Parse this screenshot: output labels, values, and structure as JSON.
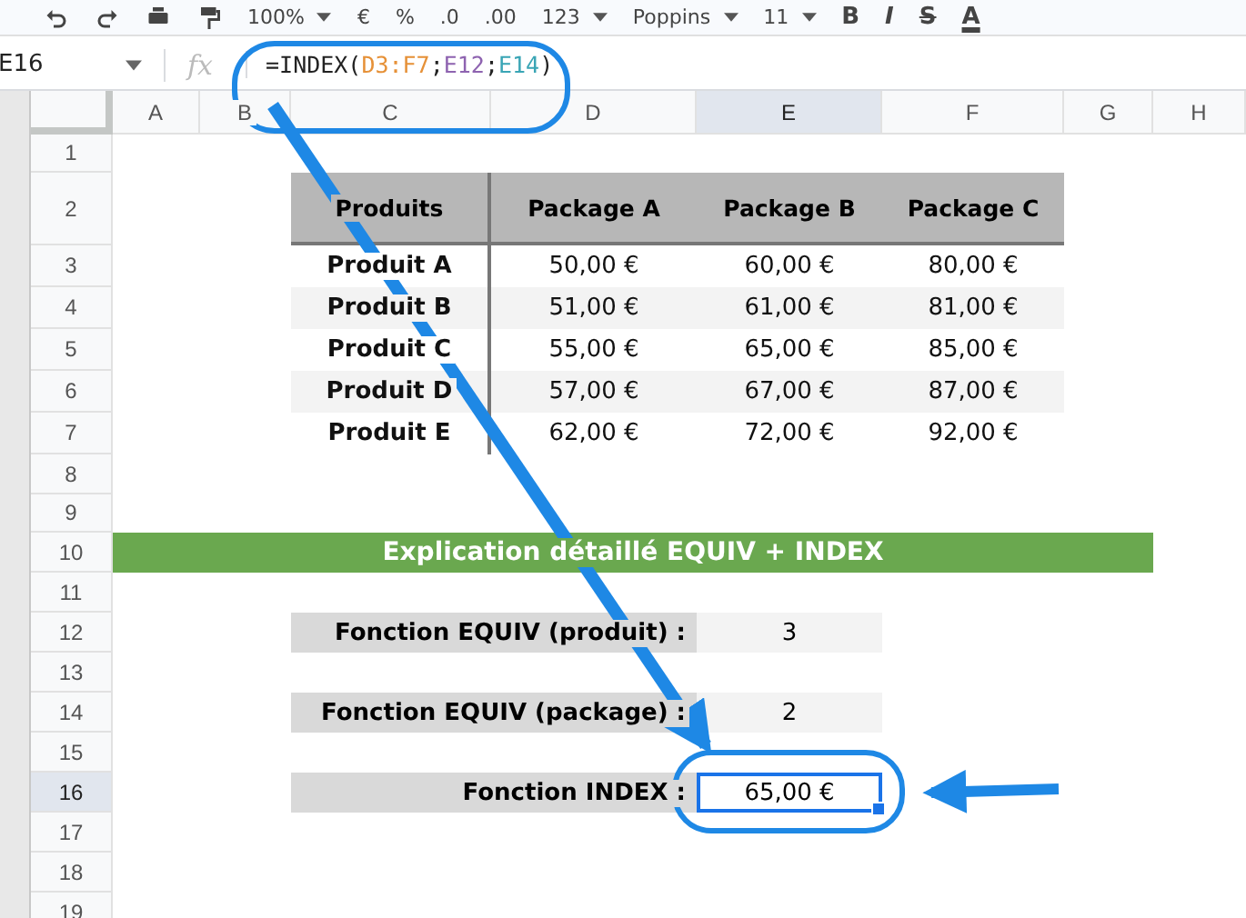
{
  "toolbar": [
    {
      "kind": "undo"
    },
    {
      "kind": "redo"
    },
    {
      "kind": "print"
    },
    {
      "kind": "paint"
    },
    {
      "kind": "text",
      "label": "100%",
      "dropdown": true
    },
    {
      "kind": "text",
      "label": "€",
      "dropdown": false
    },
    {
      "kind": "text",
      "label": "%",
      "dropdown": false
    },
    {
      "kind": "text",
      "label": ".0",
      "dropdown": false
    },
    {
      "kind": "text",
      "label": ".00",
      "dropdown": false
    },
    {
      "kind": "text",
      "label": "123",
      "dropdown": true
    },
    {
      "kind": "text",
      "label": "Poppins",
      "dropdown": true
    },
    {
      "kind": "text",
      "label": "11",
      "dropdown": true
    },
    {
      "kind": "glyph",
      "label": "B"
    },
    {
      "kind": "glyph",
      "label": "I"
    },
    {
      "kind": "glyph",
      "label": "S"
    },
    {
      "kind": "glyph",
      "label": "A"
    }
  ],
  "formula_bar": {
    "cell_ref": "E16",
    "fx": "fx",
    "parts": [
      {
        "text": "=INDEX("
      },
      {
        "text": "D3:F7",
        "color": "#e69138"
      },
      {
        "text": ";"
      },
      {
        "text": "E12",
        "color": "#8e63b0"
      },
      {
        "text": ";"
      },
      {
        "text": "E14",
        "color": "#3aa5b5"
      },
      {
        "text": ")"
      }
    ]
  },
  "columns": [
    {
      "label": "A",
      "selected": false
    },
    {
      "label": "B",
      "selected": false
    },
    {
      "label": "C",
      "selected": false
    },
    {
      "label": "D",
      "selected": false
    },
    {
      "label": "E",
      "selected": true
    },
    {
      "label": "F",
      "selected": false
    },
    {
      "label": "G",
      "selected": false
    },
    {
      "label": "H",
      "selected": false
    }
  ],
  "rows": [
    {
      "label": "1",
      "selected": false
    },
    {
      "label": "2",
      "selected": false
    },
    {
      "label": "3",
      "selected": false
    },
    {
      "label": "4",
      "selected": false
    },
    {
      "label": "5",
      "selected": false
    },
    {
      "label": "6",
      "selected": false
    },
    {
      "label": "7",
      "selected": false
    },
    {
      "label": "8",
      "selected": false
    },
    {
      "label": "9",
      "selected": false
    },
    {
      "label": "10",
      "selected": false
    },
    {
      "label": "11",
      "selected": false
    },
    {
      "label": "12",
      "selected": false
    },
    {
      "label": "13",
      "selected": false
    },
    {
      "label": "14",
      "selected": false
    },
    {
      "label": "15",
      "selected": false
    },
    {
      "label": "16",
      "selected": true
    },
    {
      "label": "17",
      "selected": false
    },
    {
      "label": "18",
      "selected": false
    },
    {
      "label": "19",
      "selected": false
    }
  ],
  "table": {
    "columns": [
      "Produits",
      "Package A",
      "Package B",
      "Package C"
    ],
    "rows": [
      [
        "Produit A",
        "50,00 €",
        "60,00 €",
        "80,00 €"
      ],
      [
        "Produit B",
        "51,00 €",
        "61,00 €",
        "81,00 €"
      ],
      [
        "Produit C",
        "55,00 €",
        "65,00 €",
        "85,00 €"
      ],
      [
        "Produit D",
        "57,00 €",
        "67,00 €",
        "87,00 €"
      ],
      [
        "Produit E",
        "62,00 €",
        "72,00 €",
        "92,00 €"
      ]
    ]
  },
  "banner": "Explication détaillé EQUIV + INDEX",
  "explanation": [
    {
      "label": "Fonction EQUIV (produit) :",
      "value": "3",
      "selected": false
    },
    {
      "label": "Fonction EQUIV (package) :",
      "value": "2",
      "selected": false
    },
    {
      "label": "Fonction INDEX :",
      "value": "65,00 €",
      "selected": true
    }
  ]
}
